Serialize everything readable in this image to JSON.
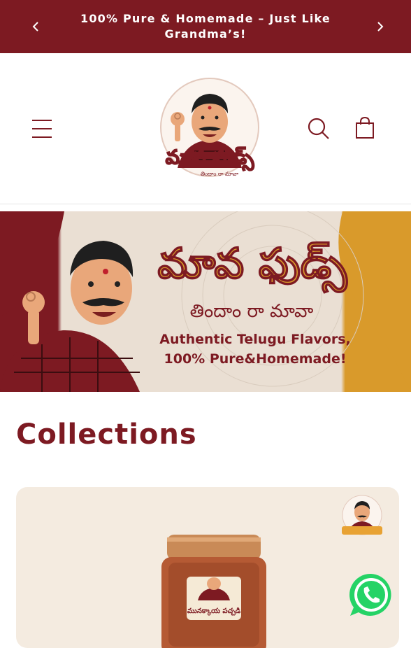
{
  "announcement": {
    "text": "100% Pure & Homemade – Just Like Grandma’s!"
  },
  "header": {
    "logo": {
      "brand_telugu": "మావ ఫుడ్స్",
      "tagline_telugu": "తిందాం రా మావా"
    }
  },
  "hero": {
    "brand_telugu": "మావ ఫుడ్స్",
    "tagline_telugu": "తిందాం రా మావా",
    "line1": "Authentic Telugu Flavors,",
    "line2": "100% Pure&Homemade!"
  },
  "collections": {
    "title": "Collections",
    "first_card": {
      "jar_label_telugu": "మునక్కాయ పచ్చడి"
    }
  },
  "colors": {
    "brand_maroon": "#7d1a22",
    "hero_gold": "#d99a2b",
    "card_bg": "#f4ebe0",
    "whatsapp_green": "#25d366"
  },
  "icons": [
    "chevron-left-icon",
    "chevron-right-icon",
    "hamburger-menu-icon",
    "search-icon",
    "cart-icon",
    "whatsapp-icon"
  ]
}
